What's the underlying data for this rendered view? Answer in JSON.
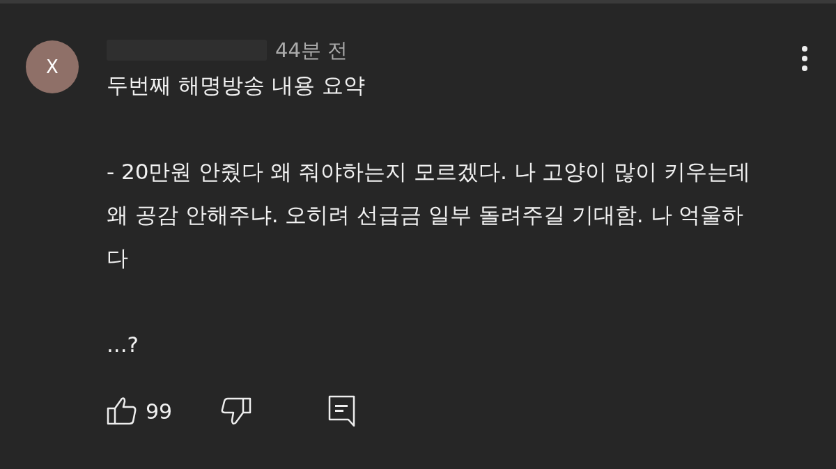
{
  "comment": {
    "avatar_letter": "X",
    "time": "44분 전",
    "paragraphs": [
      "두번째 해명방송 내용 요약",
      "- 20만원 안줬다 왜 줘야하는지 모르겠다. 나 고양이 많이 키우는데 왜 공감 안해주냐. 오히려 선급금 일부 돌려주길 기대함. 나 억울하다",
      "...?"
    ],
    "likes": "99"
  }
}
